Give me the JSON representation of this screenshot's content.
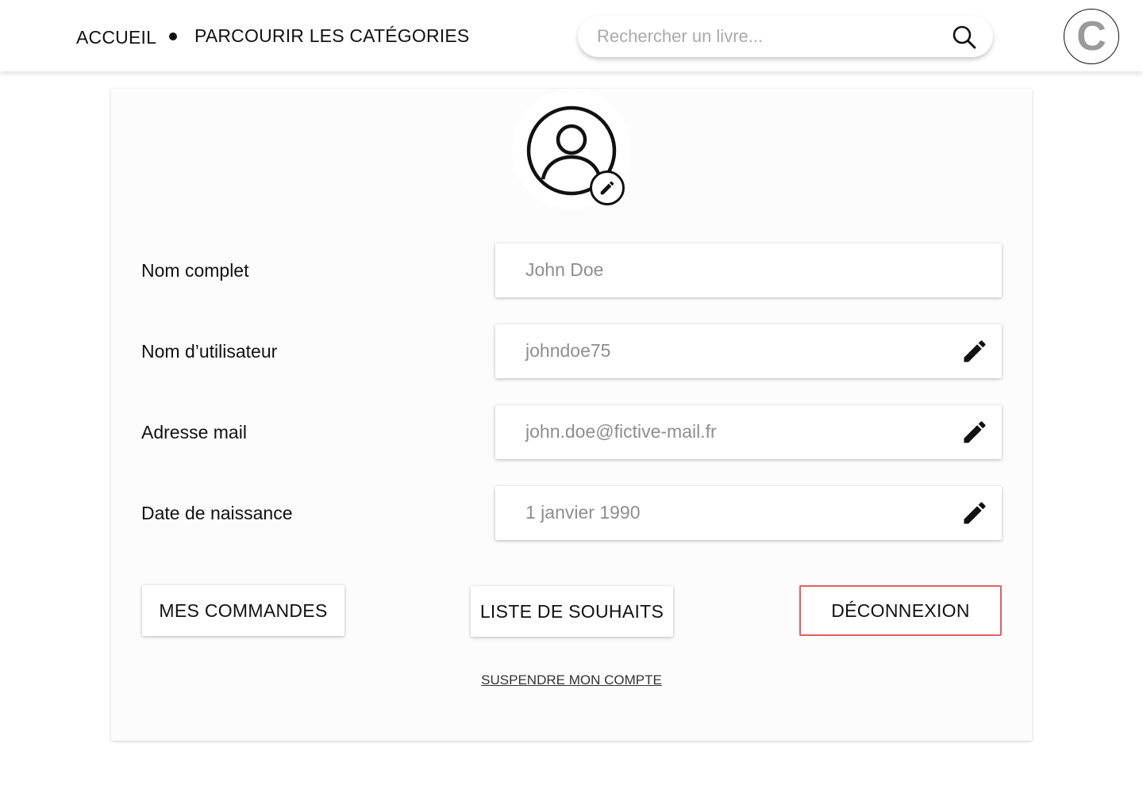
{
  "nav": {
    "home": "ACCUEIL",
    "categories": "PARCOURIR LES CATÉGORIES"
  },
  "search": {
    "placeholder": "Rechercher un livre...",
    "icon": "search-icon"
  },
  "user_avatar": {
    "initial": "C"
  },
  "profile": {
    "picture_icon": "person-circle-icon",
    "picture_edit_icon": "pencil-icon",
    "fields": [
      {
        "label": "Nom complet",
        "value": "John Doe",
        "editable": false
      },
      {
        "label": "Nom d’utilisateur",
        "value": "johndoe75",
        "editable": true
      },
      {
        "label": "Adresse mail",
        "value": "john.doe@fictive-mail.fr",
        "editable": true
      },
      {
        "label": "Date de naissance",
        "value": "1 janvier 1990",
        "editable": true
      }
    ]
  },
  "actions": {
    "orders": "MES COMMANDES",
    "wishlist": "LISTE DE SOUHAITS",
    "logout": "DÉCONNEXION",
    "suspend": "SUSPENDRE MON COMPTE"
  },
  "colors": {
    "logout_border": "#e06060",
    "field_value": "#8e8e8e",
    "avatar_initial": "#9a9a9a"
  }
}
